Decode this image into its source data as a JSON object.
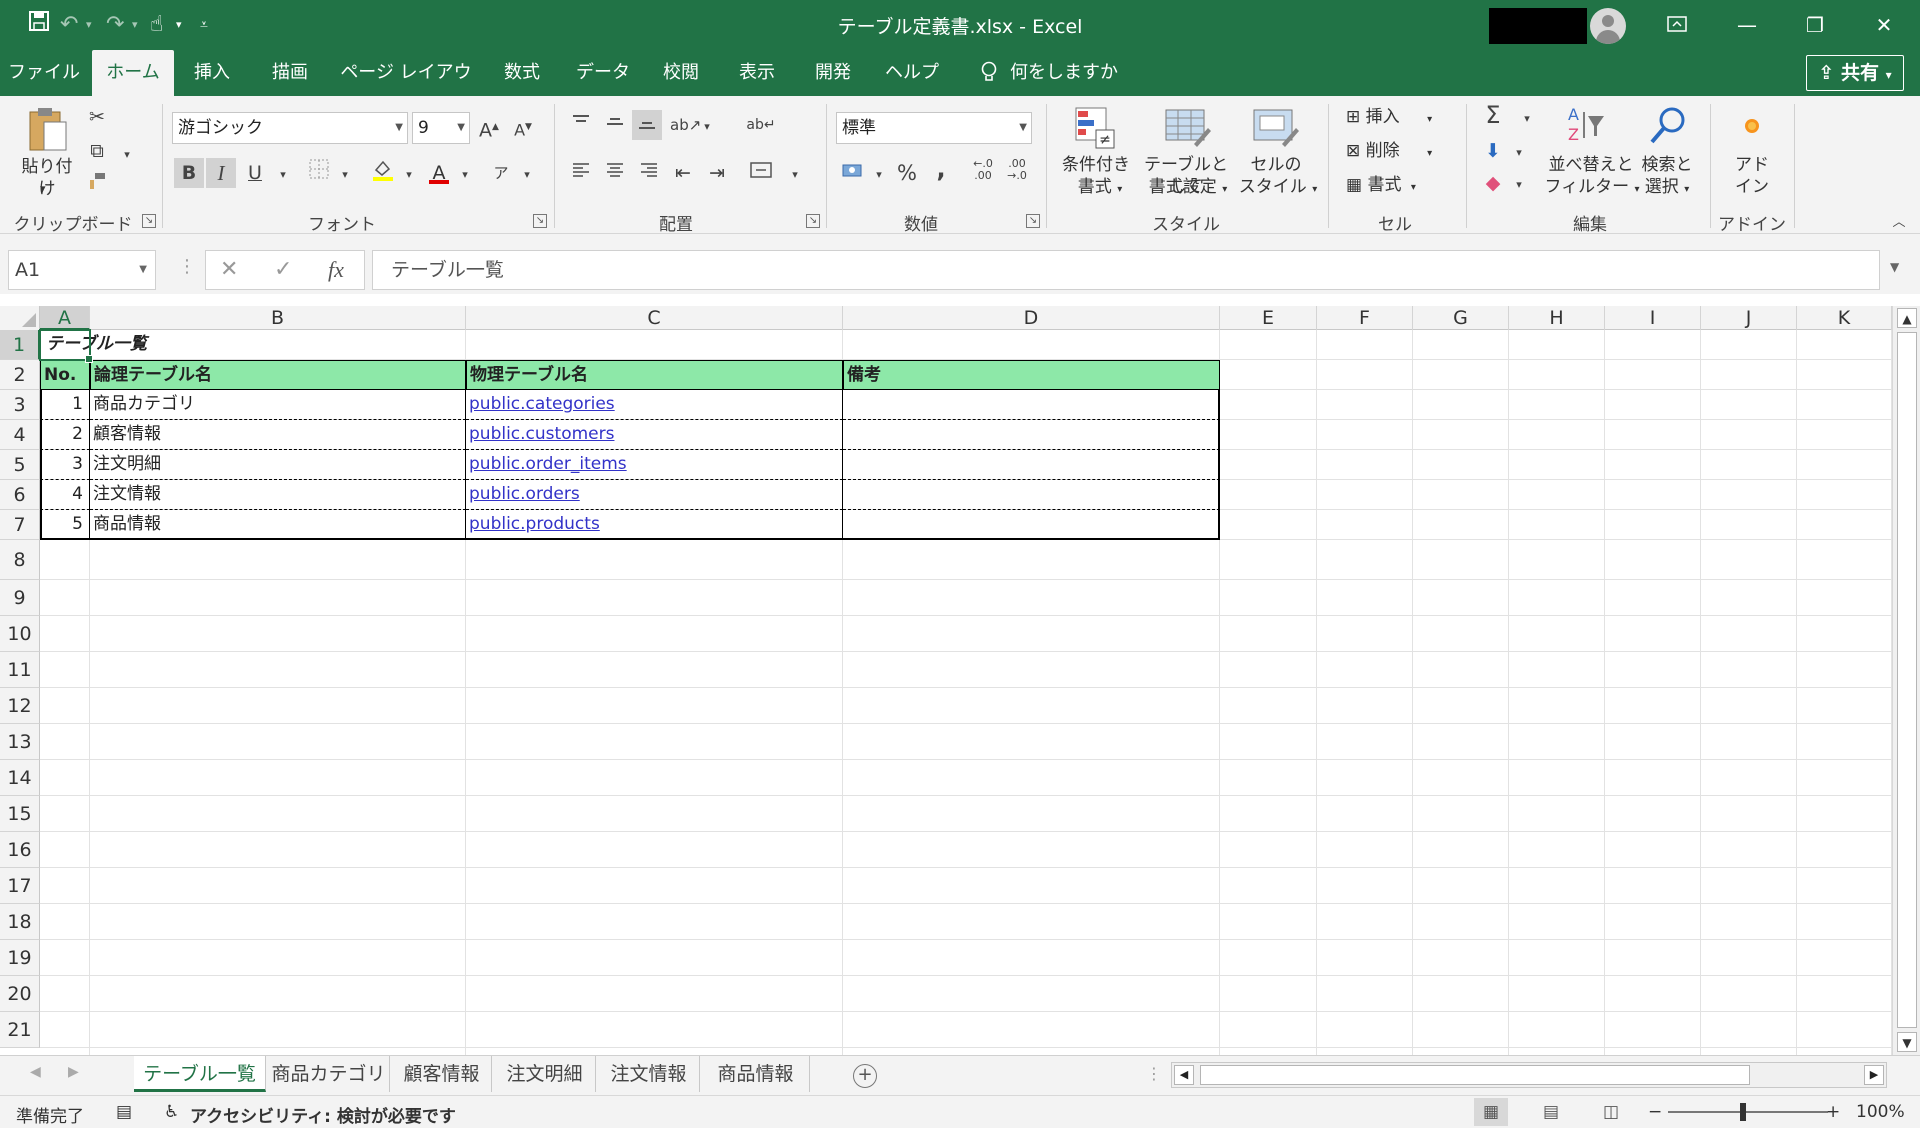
{
  "titlebar": {
    "title": "テーブル定義書.xlsx  -  Excel",
    "share_label": "共有"
  },
  "tabs": [
    {
      "label": "ファイル"
    },
    {
      "label": "ホーム"
    },
    {
      "label": "挿入"
    },
    {
      "label": "描画"
    },
    {
      "label": "ページ レイアウト"
    },
    {
      "label": "数式"
    },
    {
      "label": "データ"
    },
    {
      "label": "校閲"
    },
    {
      "label": "表示"
    },
    {
      "label": "開発"
    },
    {
      "label": "ヘルプ"
    }
  ],
  "search_label": "何をしますか",
  "ribbon": {
    "clipboard": {
      "paste": "貼り付け",
      "label": "クリップボード"
    },
    "font": {
      "name": "游ゴシック",
      "size": "9",
      "label": "フォント",
      "bold": "B",
      "italic": "I",
      "underline": "U"
    },
    "alignment": {
      "label": "配置"
    },
    "number": {
      "format": "標準",
      "label": "数値",
      "percent": "%",
      "comma": ","
    },
    "styles": {
      "conditional_l1": "条件付き",
      "conditional_l2": "書式",
      "table_l1": "テーブルとして",
      "table_l2": "書式設定",
      "cell_l1": "セルの",
      "cell_l2": "スタイル",
      "label": "スタイル"
    },
    "cells": {
      "insert": "挿入",
      "delete": "削除",
      "format": "書式",
      "label": "セル"
    },
    "editing": {
      "sort_l1": "並べ替えと",
      "sort_l2": "フィルター",
      "find_l1": "検索と",
      "find_l2": "選択",
      "label": "編集"
    },
    "addins": {
      "l1": "アド",
      "l2": "イン",
      "label": "アドイン"
    }
  },
  "formula_bar": {
    "name_box": "A1",
    "formula": "テーブル一覧",
    "fx": "fx"
  },
  "columns": [
    "A",
    "B",
    "C",
    "D",
    "E",
    "F",
    "G",
    "H",
    "I",
    "J",
    "K"
  ],
  "rows": [
    "1",
    "2",
    "3",
    "4",
    "5",
    "6",
    "7",
    "8",
    "9",
    "10",
    "11",
    "12",
    "13",
    "14",
    "15",
    "16",
    "17",
    "18",
    "19",
    "20",
    "21"
  ],
  "sheet": {
    "title": "テーブル一覧",
    "headers": {
      "no": "No.",
      "logical": "論理テーブル名",
      "physical": "物理テーブル名",
      "note": "備考"
    },
    "rows": [
      {
        "no": "1",
        "logical": "商品カテゴリ",
        "physical": "public.categories",
        "note": ""
      },
      {
        "no": "2",
        "logical": "顧客情報",
        "physical": "public.customers",
        "note": ""
      },
      {
        "no": "3",
        "logical": "注文明細",
        "physical": "public.order_items",
        "note": ""
      },
      {
        "no": "4",
        "logical": "注文情報",
        "physical": "public.orders",
        "note": ""
      },
      {
        "no": "5",
        "logical": "商品情報",
        "physical": "public.products",
        "note": ""
      }
    ]
  },
  "sheet_tabs": [
    {
      "label": "テーブル一覧"
    },
    {
      "label": "商品カテゴリ"
    },
    {
      "label": "顧客情報"
    },
    {
      "label": "注文明細"
    },
    {
      "label": "注文情報"
    },
    {
      "label": "商品情報"
    }
  ],
  "status": {
    "ready": "準備完了",
    "accessibility": "アクセシビリティ: 検討が必要です",
    "zoom": "100%"
  },
  "colors": {
    "excel_green": "#217346",
    "header_fill": "#8de8a8",
    "link": "#3232c8"
  }
}
